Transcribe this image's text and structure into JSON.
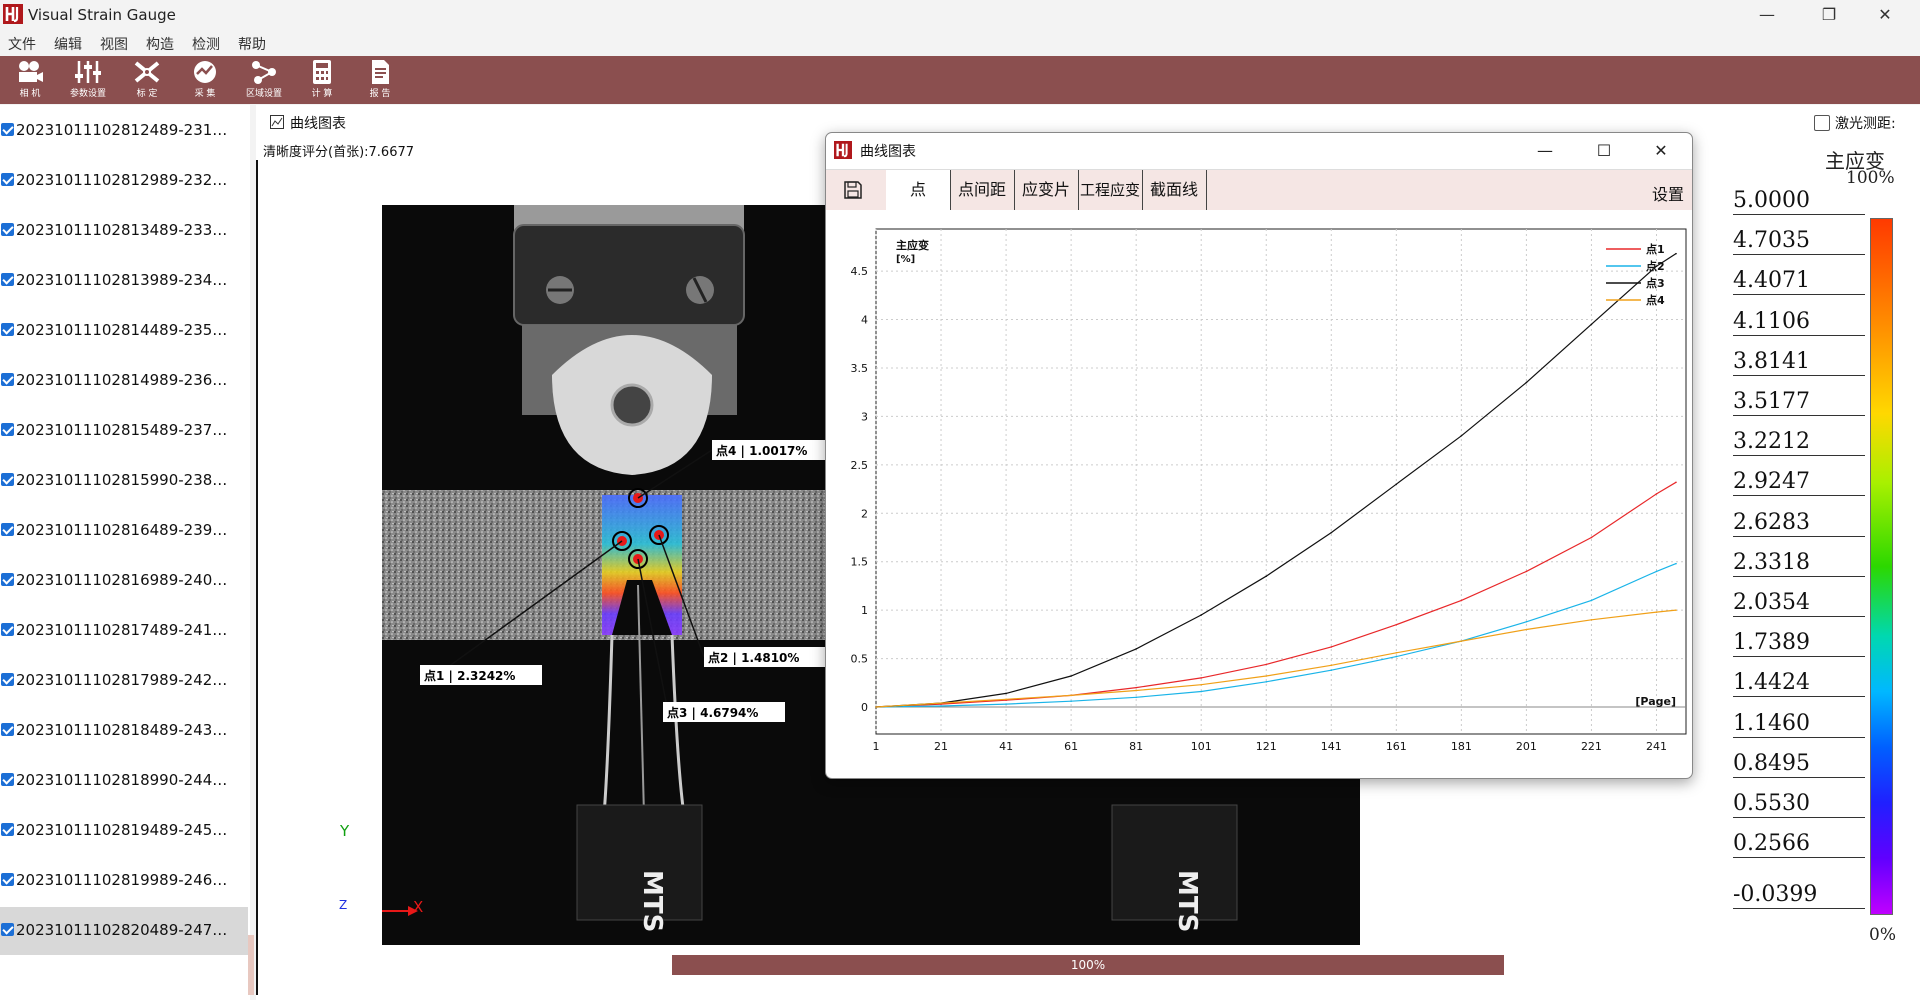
{
  "app": {
    "title": "Visual Strain Gauge"
  },
  "menu": [
    "文件",
    "编辑",
    "视图",
    "构造",
    "检测",
    "帮助"
  ],
  "toolbar": [
    {
      "label": "相 机",
      "icon": "camera-icon"
    },
    {
      "label": "参数设置",
      "icon": "sliders-icon"
    },
    {
      "label": "标 定",
      "icon": "calibrate-icon"
    },
    {
      "label": "采 集",
      "icon": "capture-icon"
    },
    {
      "label": "区域设置",
      "icon": "region-icon"
    },
    {
      "label": "计 算",
      "icon": "calculator-icon"
    },
    {
      "label": "报 告",
      "icon": "report-icon"
    }
  ],
  "files": [
    "20231011102812489-231…",
    "20231011102812989-232…",
    "20231011102813489-233…",
    "20231011102813989-234…",
    "20231011102814489-235…",
    "20231011102814989-236…",
    "20231011102815489-237…",
    "20231011102815990-238…",
    "20231011102816489-239…",
    "20231011102816989-240…",
    "20231011102817489-241…",
    "20231011102817989-242…",
    "20231011102818489-243…",
    "20231011102818990-244…",
    "20231011102819489-245…",
    "20231011102819989-246…",
    "20231011102820489-247…"
  ],
  "main": {
    "chart_tab_label": "曲线图表",
    "clarity": "清晰度评分(首张):7.6677",
    "laser_label": "激光测距:",
    "progress_label": "100%",
    "progress_value": 1.0
  },
  "image": {
    "axis_y": "Y",
    "axis_x": "X",
    "axis_z": "Z",
    "points": [
      {
        "label": "点4 | 1.0017%"
      },
      {
        "label": "点1 | 2.3242%"
      },
      {
        "label": "点2 | 1.4810%"
      },
      {
        "label": "点3 | 4.6794%"
      }
    ],
    "brand": "MTS"
  },
  "colorbar": {
    "title": "主应变",
    "max_pct": "100%",
    "min_pct": "0%",
    "values": [
      "5.0000",
      "4.7035",
      "4.4071",
      "4.1106",
      "3.8141",
      "3.5177",
      "3.2212",
      "2.9247",
      "2.6283",
      "2.3318",
      "2.0354",
      "1.7389",
      "1.4424",
      "1.1460",
      "0.8495",
      "0.5530",
      "0.2566",
      "-0.0399"
    ]
  },
  "chart_window": {
    "title": "曲线图表",
    "tabs": [
      "点",
      "点间距",
      "应变片",
      "工程应变",
      "截面线"
    ],
    "settings": "设置"
  },
  "chart_data": {
    "type": "line",
    "ylabel": "主应变",
    "yunit": "[%]",
    "xlabel": "[Page]",
    "xlim": [
      1,
      247
    ],
    "ylim": [
      0,
      4.8
    ],
    "xticks": [
      "1",
      "21",
      "41",
      "61",
      "81",
      "101",
      "121",
      "141",
      "161",
      "181",
      "201",
      "221",
      "241"
    ],
    "yticks": [
      "0",
      "0.5",
      "1",
      "1.5",
      "2",
      "2.5",
      "3",
      "3.5",
      "4",
      "4.5"
    ],
    "grid": true,
    "legend_position": "top-right",
    "x": [
      1,
      21,
      41,
      61,
      81,
      101,
      121,
      141,
      161,
      181,
      201,
      221,
      241,
      247
    ],
    "series": [
      {
        "name": "点1",
        "color": "#e8282a",
        "values": [
          0,
          0.03,
          0.07,
          0.12,
          0.2,
          0.3,
          0.44,
          0.62,
          0.85,
          1.1,
          1.4,
          1.75,
          2.2,
          2.32
        ]
      },
      {
        "name": "点2",
        "color": "#1ab4e8",
        "values": [
          0,
          0.01,
          0.03,
          0.06,
          0.1,
          0.16,
          0.26,
          0.38,
          0.52,
          0.68,
          0.88,
          1.1,
          1.4,
          1.48
        ]
      },
      {
        "name": "点3",
        "color": "#111111",
        "values": [
          0,
          0.04,
          0.14,
          0.32,
          0.6,
          0.95,
          1.35,
          1.8,
          2.3,
          2.8,
          3.35,
          3.95,
          4.55,
          4.68
        ]
      },
      {
        "name": "点4",
        "color": "#f0a018",
        "values": [
          0,
          0.04,
          0.08,
          0.12,
          0.17,
          0.23,
          0.32,
          0.43,
          0.56,
          0.68,
          0.8,
          0.9,
          0.98,
          1.0
        ]
      }
    ]
  },
  "colors": {
    "toolbar": "#8b4f4f",
    "accent": "#1c6fd6"
  }
}
